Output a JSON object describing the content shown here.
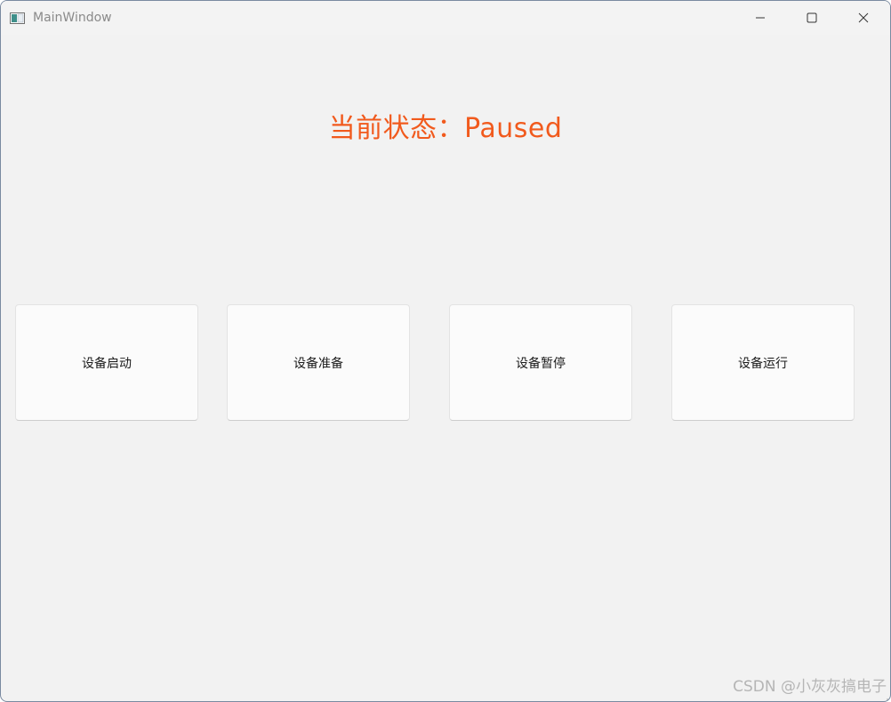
{
  "window": {
    "title": "MainWindow",
    "icons": {
      "app": "window-app-icon",
      "minimize": "minimize-icon",
      "maximize": "maximize-icon",
      "close": "close-icon"
    }
  },
  "status": {
    "label": "当前状态：",
    "value": "Paused",
    "color": "#f15a1d"
  },
  "buttons": [
    {
      "label": "设备启动"
    },
    {
      "label": "设备准备"
    },
    {
      "label": "设备暂停"
    },
    {
      "label": "设备运行"
    }
  ],
  "watermark": "CSDN @小灰灰搞电子"
}
